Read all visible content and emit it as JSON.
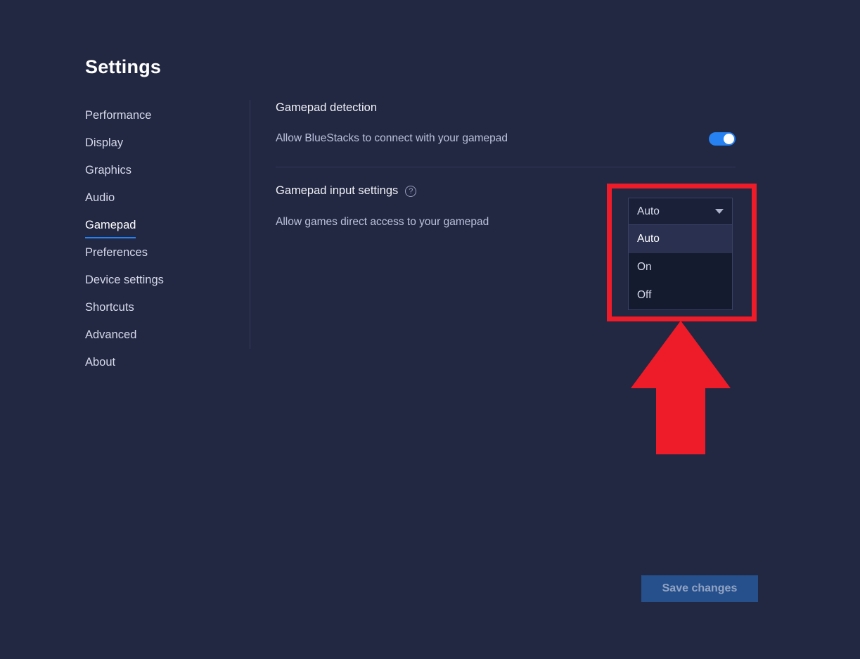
{
  "page": {
    "title": "Settings",
    "background_color": "#222742",
    "accent_color": "#2681f2",
    "annotation_color": "#ee1c29"
  },
  "sidebar": {
    "items": [
      {
        "label": "Performance",
        "active": false
      },
      {
        "label": "Display",
        "active": false
      },
      {
        "label": "Graphics",
        "active": false
      },
      {
        "label": "Audio",
        "active": false
      },
      {
        "label": "Gamepad",
        "active": true
      },
      {
        "label": "Preferences",
        "active": false
      },
      {
        "label": "Device settings",
        "active": false
      },
      {
        "label": "Shortcuts",
        "active": false
      },
      {
        "label": "Advanced",
        "active": false
      },
      {
        "label": "About",
        "active": false
      }
    ]
  },
  "main": {
    "sections": [
      {
        "heading": "Gamepad detection",
        "row_label": "Allow BlueStacks to connect with your gamepad",
        "control": "toggle",
        "toggle_state": "on"
      },
      {
        "heading": "Gamepad input settings",
        "help_icon": "help-circle-icon",
        "help_glyph": "?",
        "row_label": "Allow games direct access to your gamepad",
        "control": "dropdown"
      }
    ]
  },
  "dropdown": {
    "name": "gamepad-input-mode",
    "selected": "Auto",
    "expanded": true,
    "caret_icon": "chevron-down-icon",
    "options": [
      {
        "label": "Auto",
        "highlighted": true
      },
      {
        "label": "On",
        "highlighted": false
      },
      {
        "label": "Off",
        "highlighted": false
      }
    ]
  },
  "footer": {
    "save_label": "Save changes",
    "save_enabled": false
  },
  "annotations": {
    "highlight_box": "red-highlight-rectangle",
    "arrow": "red-up-arrow-icon"
  }
}
